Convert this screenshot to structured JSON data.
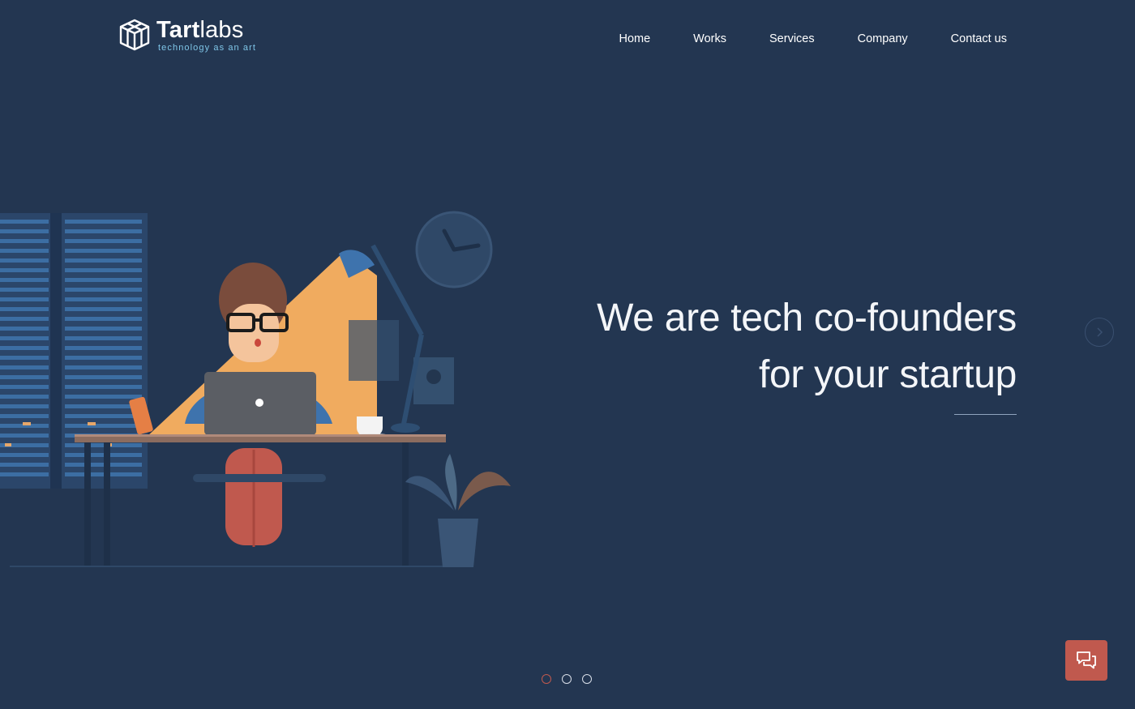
{
  "header": {
    "logo": {
      "word_bold": "Tart",
      "word_light": "labs",
      "tagline": "technology as an art"
    },
    "nav": [
      {
        "label": "Home"
      },
      {
        "label": "Works"
      },
      {
        "label": "Services"
      },
      {
        "label": "Company"
      },
      {
        "label": "Contact us"
      }
    ]
  },
  "hero": {
    "headline_line1": "We are tech co-founders",
    "headline_line2": "for your startup",
    "slides": {
      "count": 3,
      "active_index": 0
    }
  },
  "icons": {
    "logo": "cube-logo-icon",
    "next": "chevron-right-icon",
    "chat": "chat-bubbles-icon"
  },
  "colors": {
    "background": "#233651",
    "accent": "#c0594e",
    "tagline": "#7fc6e8",
    "lamp_light": "#f0ab5f"
  }
}
